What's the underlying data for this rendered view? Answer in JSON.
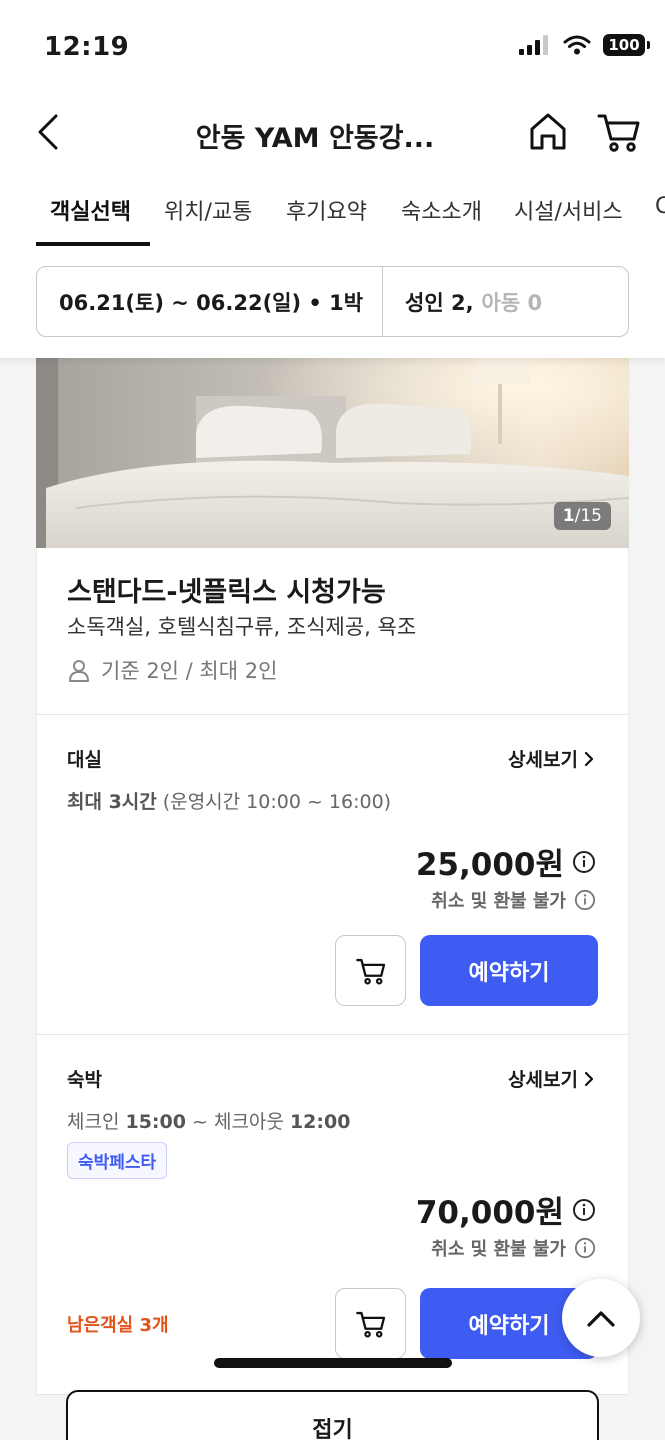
{
  "status_bar": {
    "time": "12:19",
    "battery": "100"
  },
  "header": {
    "title": "안동 YAM 안동강..."
  },
  "tabs": [
    {
      "label": "객실선택"
    },
    {
      "label": "위치/교통"
    },
    {
      "label": "후기요약"
    },
    {
      "label": "숙소소개"
    },
    {
      "label": "시설/서비스"
    },
    {
      "label": "C"
    }
  ],
  "selector": {
    "dates": "06.21(토) ~ 06.22(일) • 1박",
    "adults": "성인 2,",
    "children": "아동 0"
  },
  "room": {
    "photo_current": "1",
    "photo_total": "/15",
    "name": "스탠다드-넷플릭스 시청가능",
    "amenities": "소독객실, 호텔식침구류, 조식제공, 욕조",
    "capacity": "기준 2인 / 최대 2인"
  },
  "offers": [
    {
      "type": "대실",
      "detail_link": "상세보기",
      "sub_bold": "최대 3시간",
      "sub_rest": " (운영시간 10:00 ~ 16:00)",
      "price": "25,000원",
      "refund": "취소 및 환불 불가",
      "reserve_label": "예약하기"
    },
    {
      "type": "숙박",
      "detail_link": "상세보기",
      "checkin_label": "체크인 ",
      "checkin_time": "15:00",
      "checkout_label": " ~ 체크아웃 ",
      "checkout_time": "12:00",
      "badge": "숙박페스타",
      "price": "70,000원",
      "refund": "취소 및 환불 불가",
      "remaining": "남은객실 3개",
      "reserve_label": "예약하기"
    }
  ],
  "more_button": "접기",
  "colors": {
    "accent": "#3f5cf2",
    "warning": "#e0531a"
  }
}
